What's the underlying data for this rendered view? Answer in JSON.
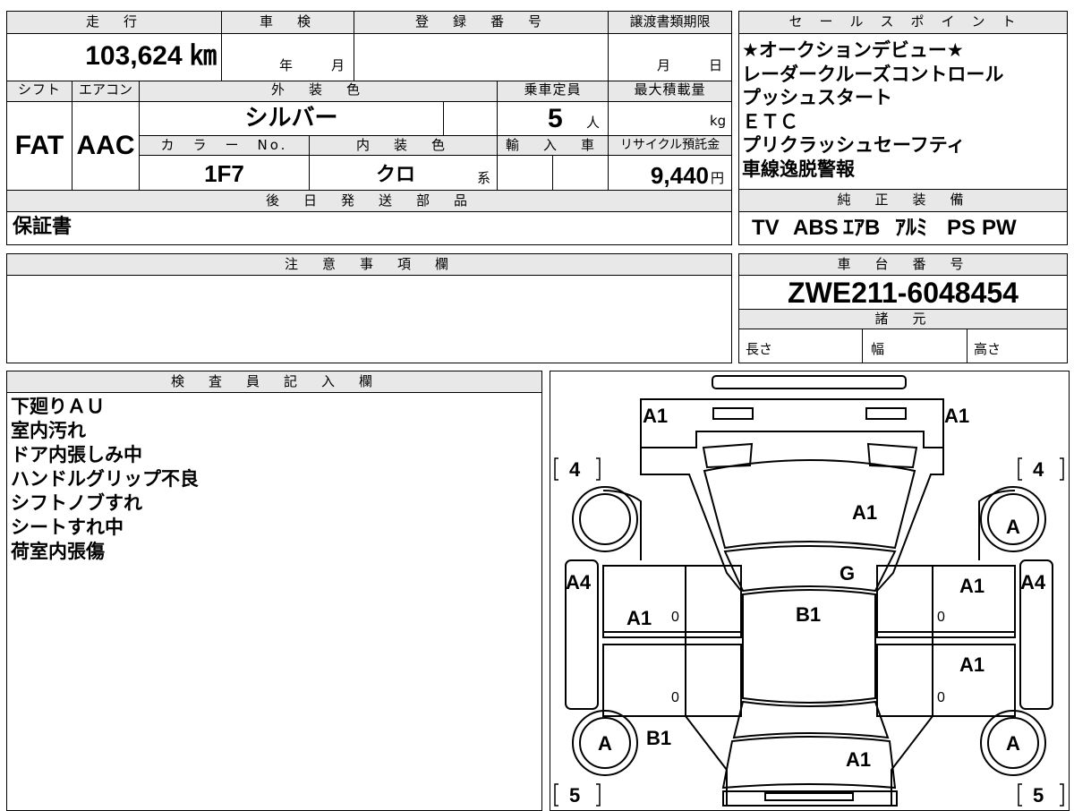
{
  "basic": {
    "mileage_label": "走　行",
    "mileage": "103,624 ㎞",
    "shaken_label": "車　検",
    "shaken_year_unit": "年",
    "shaken_month_unit": "月",
    "registration_label": "登　録　番　号",
    "transfer_deadline_label": "譲渡書類期限",
    "transfer_month_unit": "月",
    "transfer_day_unit": "日"
  },
  "spec": {
    "shift_label": "シフト",
    "shift": "FAT",
    "aircon_label": "エアコン",
    "aircon": "AAC",
    "exterior_color_label": "外　装　色",
    "exterior_color": "シルバー",
    "capacity_label": "乗車定員",
    "capacity": "5",
    "capacity_unit": "人",
    "max_load_label": "最大積載量",
    "max_load_unit": "kg",
    "color_no_label": "カ　ラ　ー　No.",
    "color_no": "1F7",
    "interior_color_label": "内　装　色",
    "interior_color": "クロ",
    "interior_color_suffix": "系",
    "import_label": "輸　入　車",
    "recycle_label": "リサイクル預託金",
    "recycle_fee": "9,440",
    "recycle_unit": "円"
  },
  "later_parts": {
    "label": "後　日　発　送　部　品",
    "value": "保証書"
  },
  "sales_points": {
    "label": "セ　ー　ル　ス　ポ　イ　ン　ト",
    "items": [
      "★オークションデビュー★",
      "レーダークルーズコントロール",
      "プッシュスタート",
      "ＥＴＣ",
      "プリクラッシュセーフティ",
      "車線逸脱警報"
    ]
  },
  "equipment": {
    "label": "純　正　装　備",
    "items": [
      "TV",
      "ABS",
      "ｴｱB",
      "ｱﾙﾐ",
      "PS",
      "PW"
    ]
  },
  "caution": {
    "label": "注　意　事　項　欄"
  },
  "chassis": {
    "label": "車　台　番　号",
    "number": "ZWE211-6048454",
    "specs_label": "諸　元",
    "length_label": "長さ",
    "width_label": "幅",
    "height_label": "高さ"
  },
  "inspector": {
    "label": "検　査　員　記　入　欄",
    "notes": [
      "下廻りＡＵ",
      "室内汚れ",
      "ドア内張しみ中",
      "ハンドルグリップ不良",
      "シフトノブすれ",
      "シートすれ中",
      "荷室内張傷"
    ]
  },
  "diagram": {
    "front_left_bumper": "A1",
    "front_right_bumper": "A1",
    "bonnet": "A1",
    "windshield": "G",
    "roof": "B1",
    "front_left_door": "A1",
    "front_right_door": "A1",
    "rear_right_door": "A1",
    "left_front_fender": "A4",
    "right_front_fender": "A4",
    "front_left_wheel": "",
    "front_right_wheel": "A",
    "rear_left_wheel": "A",
    "rear_right_wheel": "A",
    "rear_left_quarter": "B1",
    "rear_gate": "A1",
    "front_left_tire": "4",
    "front_right_tire": "4",
    "rear_left_tire": "5",
    "rear_right_tire": "5",
    "door_zero": "0"
  }
}
